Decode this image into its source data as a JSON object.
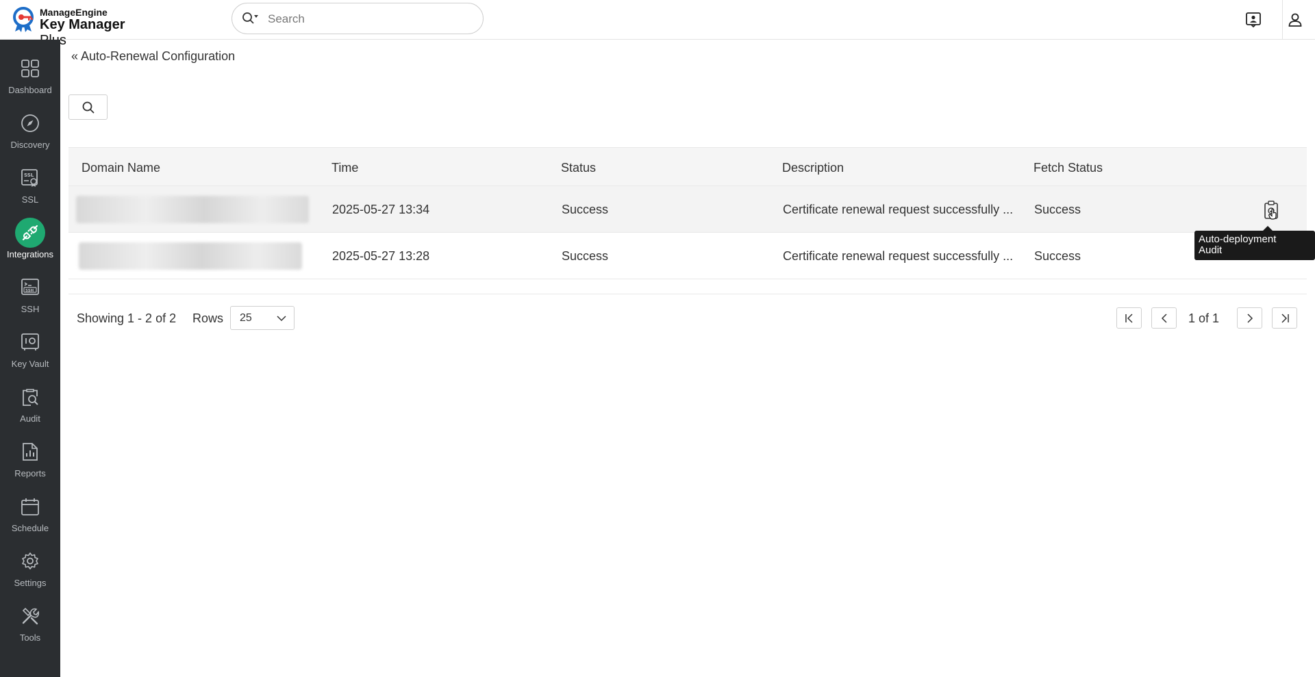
{
  "app": {
    "brand_top": "ManageEngine",
    "brand_main_bold": "Key Manager",
    "brand_main_light": " Plus"
  },
  "search": {
    "placeholder": "Search"
  },
  "sidebar": {
    "items": [
      {
        "label": "Dashboard",
        "icon": "dashboard-icon"
      },
      {
        "label": "Discovery",
        "icon": "compass-icon"
      },
      {
        "label": "SSL",
        "icon": "ssl-certificate-icon"
      },
      {
        "label": "Integrations",
        "icon": "plug-icon",
        "active": true
      },
      {
        "label": "SSH",
        "icon": "ssh-terminal-icon"
      },
      {
        "label": "Key Vault",
        "icon": "vault-icon"
      },
      {
        "label": "Audit",
        "icon": "audit-icon"
      },
      {
        "label": "Reports",
        "icon": "reports-icon"
      },
      {
        "label": "Schedule",
        "icon": "calendar-icon"
      },
      {
        "label": "Settings",
        "icon": "gear-icon"
      },
      {
        "label": "Tools",
        "icon": "tools-icon"
      }
    ]
  },
  "breadcrumb": {
    "label": "« Auto-Renewal Configuration"
  },
  "table": {
    "columns": [
      "Domain Name",
      "Time",
      "Status",
      "Description",
      "Fetch Status"
    ],
    "rows": [
      {
        "time": "2025-05-27 13:34",
        "status": "Success",
        "description": "Certificate renewal request successfully ...",
        "fetch_status": "Success"
      },
      {
        "time": "2025-05-27 13:28",
        "status": "Success",
        "description": "Certificate renewal request successfully ...",
        "fetch_status": "Success"
      }
    ]
  },
  "tooltip": {
    "line1": "Auto-deployment",
    "line2": "Audit"
  },
  "pagination": {
    "showing": "Showing 1 - 2 of 2",
    "rows_label": "Rows",
    "rows_value": "25",
    "page_text": "1 of 1"
  },
  "colors": {
    "accent": "#1fa971",
    "sidebar_bg": "#2b2e31"
  }
}
